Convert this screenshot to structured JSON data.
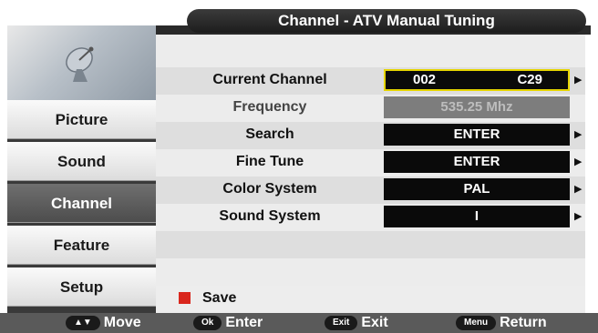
{
  "header": {
    "title": "Channel - ATV Manual Tuning"
  },
  "sidebar": {
    "items": [
      {
        "label": "Picture"
      },
      {
        "label": "Sound"
      },
      {
        "label": "Channel"
      },
      {
        "label": "Feature"
      },
      {
        "label": "Setup"
      }
    ],
    "active": "Channel",
    "logo_icon": "satellite-dish-icon"
  },
  "settings": {
    "current_channel": {
      "label": "Current Channel",
      "number": "002",
      "name": "C29"
    },
    "frequency": {
      "label": "Frequency",
      "value": "535.25 Mhz"
    },
    "search": {
      "label": "Search",
      "value": "ENTER"
    },
    "fine_tune": {
      "label": "Fine Tune",
      "value": "ENTER"
    },
    "color_system": {
      "label": "Color System",
      "value": "PAL"
    },
    "sound_system": {
      "label": "Sound System",
      "value": "I"
    }
  },
  "save": {
    "label": "Save",
    "color": "#d9261c"
  },
  "footer": {
    "move": {
      "key": "▲▼",
      "label": "Move"
    },
    "enter": {
      "key": "Ok",
      "label": "Enter"
    },
    "exit": {
      "key": "Exit",
      "label": "Exit"
    },
    "return": {
      "key": "Menu",
      "label": "Return"
    }
  },
  "colors": {
    "selected_border": "#e5d400",
    "value_bg": "#0a0a0a",
    "active_tab": "#5a5a5a"
  }
}
